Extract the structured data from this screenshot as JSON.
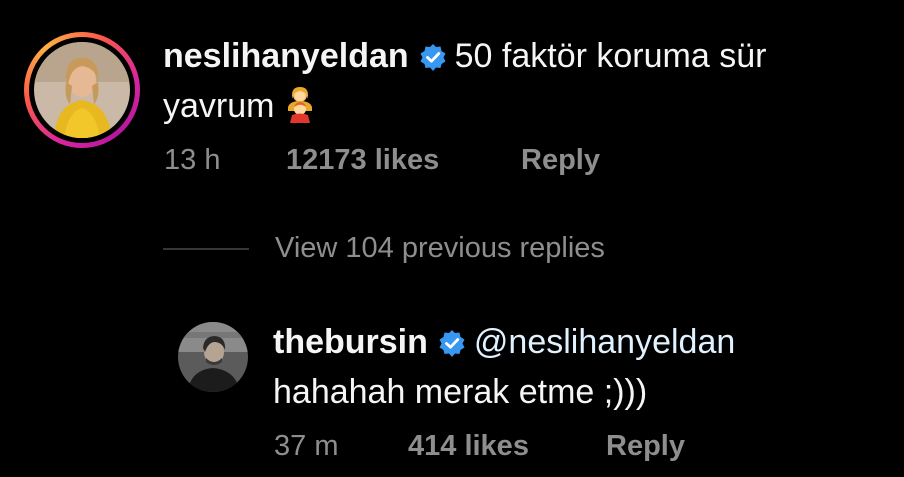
{
  "comment": {
    "username": "neslihanyeldan",
    "text_line1": "50 faktör koruma sür",
    "text_line2": "yavrum",
    "emoji_icon": "woman-and-boy-emoji",
    "time": "13 h",
    "likes": "12173 likes",
    "reply_label": "Reply"
  },
  "view_replies": "View 104 previous replies",
  "reply": {
    "username": "thebursin",
    "mention": "@neslihanyeldan",
    "text_line2": "hahahah merak etme ;)))",
    "time": "37 m",
    "likes": "414 likes",
    "reply_label": "Reply"
  },
  "colors": {
    "background": "#000000",
    "text": "#f5f5f5",
    "meta": "#8e8e8e",
    "verified": "#3897f0"
  }
}
